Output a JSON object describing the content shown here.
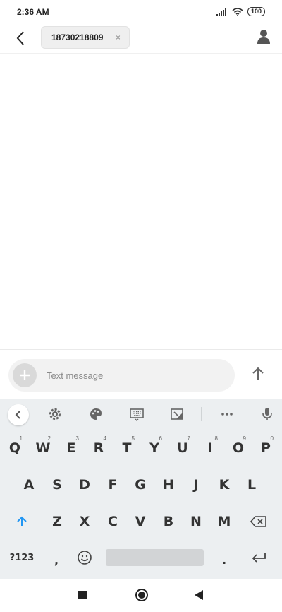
{
  "status_bar": {
    "time": "2:36 AM",
    "battery": "100"
  },
  "header": {
    "recipient": "18730218809",
    "remove_symbol": "×"
  },
  "composer": {
    "placeholder": "Text message"
  },
  "keyboard": {
    "row1": [
      {
        "label": "Q",
        "hint": "1"
      },
      {
        "label": "W",
        "hint": "2"
      },
      {
        "label": "E",
        "hint": "3"
      },
      {
        "label": "R",
        "hint": "4"
      },
      {
        "label": "T",
        "hint": "5"
      },
      {
        "label": "Y",
        "hint": "6"
      },
      {
        "label": "U",
        "hint": "7"
      },
      {
        "label": "I",
        "hint": "8"
      },
      {
        "label": "O",
        "hint": "9"
      },
      {
        "label": "P",
        "hint": "0"
      }
    ],
    "row2": [
      "A",
      "S",
      "D",
      "F",
      "G",
      "H",
      "J",
      "K",
      "L"
    ],
    "row3": [
      "Z",
      "X",
      "C",
      "V",
      "B",
      "N",
      "M"
    ],
    "symbols_label": "?123",
    "comma": ",",
    "period": "."
  },
  "colors": {
    "shift_accent": "#2196f3",
    "keyboard_bg": "#eceff1"
  }
}
